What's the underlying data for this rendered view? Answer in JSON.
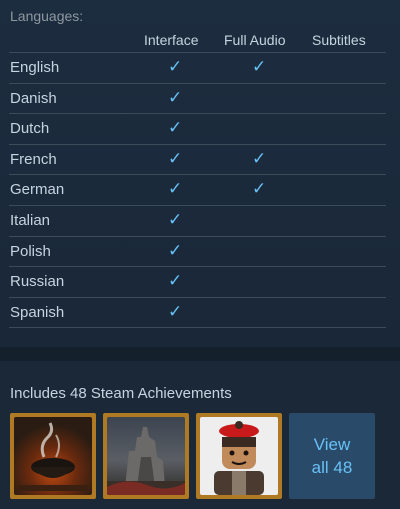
{
  "languages": {
    "title": "Languages:",
    "columns": {
      "interface": "Interface",
      "full_audio": "Full Audio",
      "subtitles": "Subtitles"
    },
    "check_glyph": "✓",
    "rows": [
      {
        "name": "English",
        "interface": true,
        "full_audio": true,
        "subtitles": false
      },
      {
        "name": "Danish",
        "interface": true,
        "full_audio": false,
        "subtitles": false
      },
      {
        "name": "Dutch",
        "interface": true,
        "full_audio": false,
        "subtitles": false
      },
      {
        "name": "French",
        "interface": true,
        "full_audio": true,
        "subtitles": false
      },
      {
        "name": "German",
        "interface": true,
        "full_audio": true,
        "subtitles": false
      },
      {
        "name": "Italian",
        "interface": true,
        "full_audio": false,
        "subtitles": false
      },
      {
        "name": "Polish",
        "interface": true,
        "full_audio": false,
        "subtitles": false
      },
      {
        "name": "Russian",
        "interface": true,
        "full_audio": false,
        "subtitles": false
      },
      {
        "name": "Spanish",
        "interface": true,
        "full_audio": false,
        "subtitles": false
      }
    ]
  },
  "achievements": {
    "title": "Includes 48 Steam Achievements",
    "icons": [
      "cauldron-achievement-icon",
      "castle-achievement-icon",
      "lego-character-achievement-icon"
    ],
    "view_all_line1": "View",
    "view_all_line2": "all 48"
  },
  "colors": {
    "accent": "#67c1f5",
    "frame": "#b07a24",
    "panel": "#1b2838"
  }
}
